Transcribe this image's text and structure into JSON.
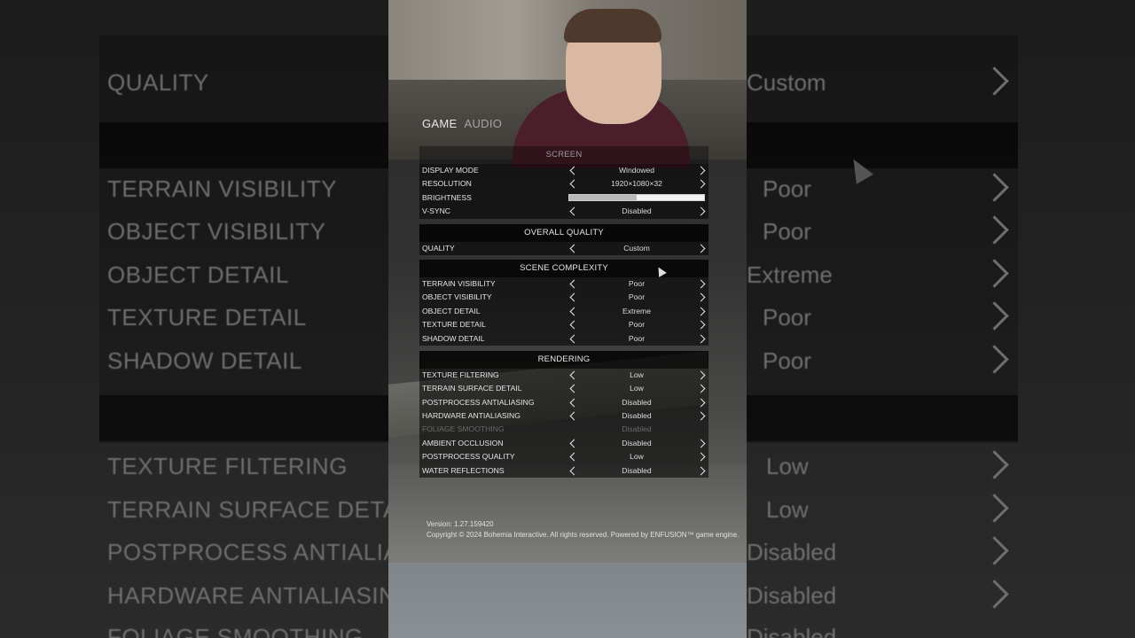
{
  "tabs": [
    {
      "label": "GAME"
    },
    {
      "label": "AUDIO"
    }
  ],
  "screen_section": "SCREEN",
  "screen_rows": [
    {
      "label": "DISPLAY MODE",
      "value": "Windowed"
    },
    {
      "label": "RESOLUTION",
      "value": "1920×1080×32"
    }
  ],
  "brightness": {
    "label": "BRIGHTNESS",
    "level": 0.5
  },
  "vsync": {
    "label": "V-SYNC",
    "value": "Disabled"
  },
  "overall_quality": {
    "title": "OVERALL QUALITY",
    "rows": [
      {
        "label": "QUALITY",
        "value": "Custom"
      }
    ]
  },
  "scene_complexity": {
    "title": "SCENE COMPLEXITY",
    "rows": [
      {
        "label": "TERRAIN VISIBILITY",
        "value": "Poor"
      },
      {
        "label": "OBJECT VISIBILITY",
        "value": "Poor"
      },
      {
        "label": "OBJECT DETAIL",
        "value": "Extreme"
      },
      {
        "label": "TEXTURE DETAIL",
        "value": "Poor"
      },
      {
        "label": "SHADOW DETAIL",
        "value": "Poor"
      }
    ]
  },
  "rendering": {
    "title": "RENDERING",
    "rows": [
      {
        "label": "TEXTURE FILTERING",
        "value": "Low",
        "disabled": false
      },
      {
        "label": "TERRAIN SURFACE DETAIL",
        "value": "Low",
        "disabled": false
      },
      {
        "label": "POSTPROCESS ANTIALIASING",
        "value": "Disabled",
        "disabled": false
      },
      {
        "label": "HARDWARE ANTIALIASING",
        "value": "Disabled",
        "disabled": false
      },
      {
        "label": "FOLIAGE SMOOTHING",
        "value": "Disabled",
        "disabled": true
      },
      {
        "label": "AMBIENT OCCLUSION",
        "value": "Disabled",
        "disabled": false
      },
      {
        "label": "POSTPROCESS QUALITY",
        "value": "Low",
        "disabled": false
      },
      {
        "label": "WATER REFLECTIONS",
        "value": "Disabled",
        "disabled": false
      }
    ]
  },
  "footer": {
    "version": "Version: 1.27.159420",
    "copyright": "Copyright © 2024 Bohemia Interactive. All rights reserved. Powered by ENFUSION™ game engine."
  },
  "background": {
    "rows": [
      {
        "label": "QUALITY",
        "value": "Custom"
      },
      {
        "label": "TERRAIN VISIBILITY",
        "value": "Poor"
      },
      {
        "label": "OBJECT VISIBILITY",
        "value": "Poor"
      },
      {
        "label": "OBJECT DETAIL",
        "value": "Extreme"
      },
      {
        "label": "TEXTURE DETAIL",
        "value": "Poor"
      },
      {
        "label": "SHADOW DETAIL",
        "value": "Poor"
      },
      {
        "label": "TEXTURE FILTERING",
        "value": "Low"
      },
      {
        "label": "TERRAIN SURFACE DETA",
        "value": "Low"
      },
      {
        "label": "POSTPROCESS ANTIALIA",
        "value": "Disabled"
      },
      {
        "label": "HARDWARE ANTIALIASING",
        "value": "Disabled"
      },
      {
        "label": "FOLIAGE SMOOTHING",
        "value": "Disabled"
      }
    ]
  },
  "colors": {
    "panel_bg": "#000000",
    "text": "#e4e4e4",
    "disabled_text": "#6a6a6a"
  }
}
